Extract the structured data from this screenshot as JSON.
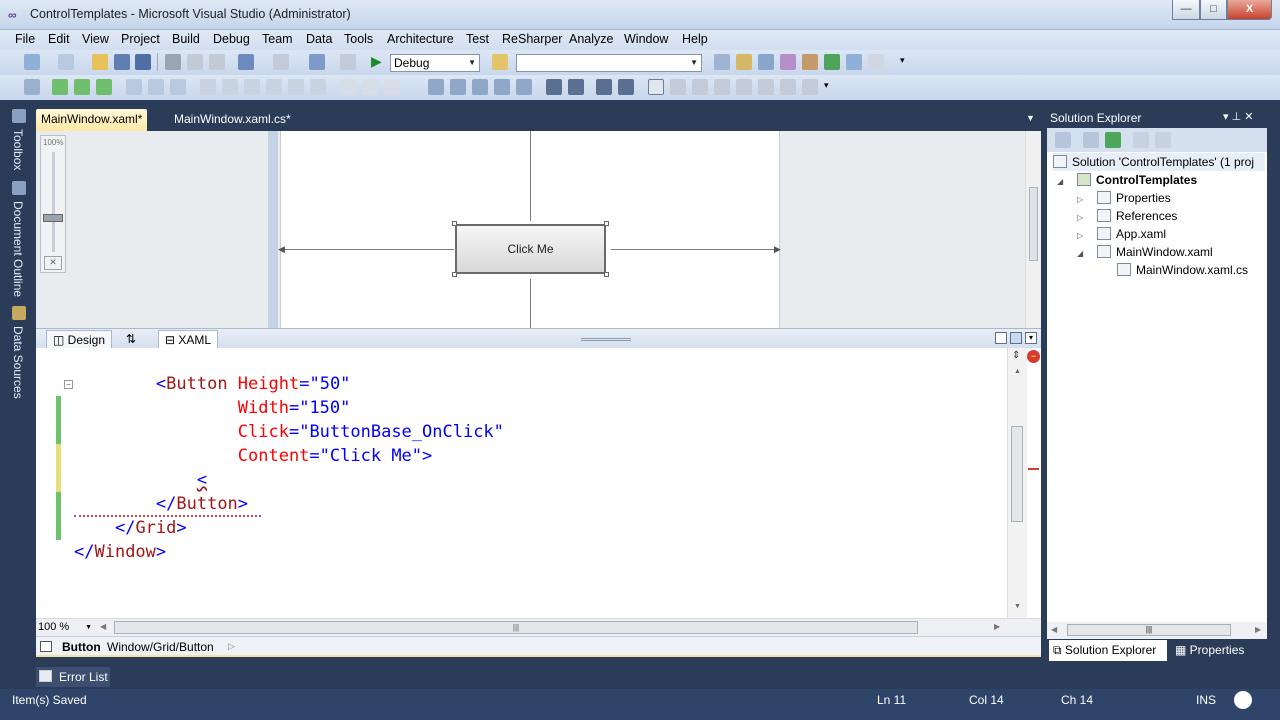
{
  "window": {
    "title": "ControlTemplates - Microsoft Visual Studio (Administrator)",
    "buttons": {
      "minimize": "—",
      "maximize": "□",
      "close": "X"
    }
  },
  "menu": [
    "File",
    "Edit",
    "View",
    "Project",
    "Build",
    "Debug",
    "Team",
    "Data",
    "Tools",
    "Architecture",
    "Test",
    "ReSharper",
    "Analyze",
    "Window",
    "Help"
  ],
  "toolbar": {
    "config_value": "Debug",
    "platform_value": ""
  },
  "left_dock": {
    "tabs": [
      "Toolbox",
      "Document Outline",
      "Data Sources"
    ]
  },
  "doc_tabs": [
    {
      "label": "MainWindow.xaml*",
      "active": true
    },
    {
      "label": "MainWindow.xaml.cs*",
      "active": false
    }
  ],
  "designer": {
    "zoom_label": "100%",
    "button_content": "Click Me"
  },
  "split_tabs": {
    "design": "Design",
    "swap": "⇅",
    "xaml": "XAML"
  },
  "code": {
    "line1": {
      "indent": "        ",
      "open": "<",
      "tag": "Button",
      "a1": " Height",
      "eq1": "=",
      "v1": "\"50\""
    },
    "line2": {
      "indent": "                ",
      "a": "Width",
      "eq": "=",
      "v": "\"150\""
    },
    "line3": {
      "indent": "                ",
      "a": "Click",
      "eq": "=",
      "v": "\"ButtonBase_OnClick\""
    },
    "line4": {
      "indent": "                ",
      "a": "Content",
      "eq": "=",
      "v": "\"Click Me\"",
      "close": ">"
    },
    "line5": {
      "indent": "            ",
      "text": "<"
    },
    "line6": {
      "indent": "        ",
      "open": "</",
      "tag": "Button",
      "close": ">"
    },
    "line7": {
      "indent": "    ",
      "open": "</",
      "tag": "Grid",
      "close": ">"
    },
    "line8": {
      "indent": "",
      "open": "</",
      "tag": "Window",
      "close": ">"
    }
  },
  "editor": {
    "zoom_value": "100 %"
  },
  "breadcrumb": {
    "element": "Button",
    "path": "Window/Grid/Button"
  },
  "solution_explorer": {
    "title": "Solution Explorer",
    "pin": "▾ ⊥ ✕",
    "items": [
      {
        "label": "Solution 'ControlTemplates' (1 proj",
        "expander": ""
      },
      {
        "label": "ControlTemplates",
        "expander": "◢"
      },
      {
        "label": "Properties",
        "expander": "▷"
      },
      {
        "label": "References",
        "expander": "▷"
      },
      {
        "label": "App.xaml",
        "expander": "▷"
      },
      {
        "label": "MainWindow.xaml",
        "expander": "◢"
      },
      {
        "label": "MainWindow.xaml.cs",
        "expander": ""
      }
    ],
    "bottom_tabs": [
      "Solution Explorer",
      "Properties"
    ]
  },
  "error_list": {
    "label": "Error List"
  },
  "status": {
    "message": "Item(s) Saved",
    "ln": "Ln 11",
    "col": "Col 14",
    "ch": "Ch 14",
    "mode": "INS"
  },
  "colors": {
    "chrome": "#2b3c59",
    "active_tab": "#ffe8a6",
    "xml_tag": "#a31515",
    "xml_attr": "#ff0000",
    "xml_value": "#0000ff",
    "change_saved": "#6cc36c",
    "change_unsaved": "#e4e07a"
  }
}
